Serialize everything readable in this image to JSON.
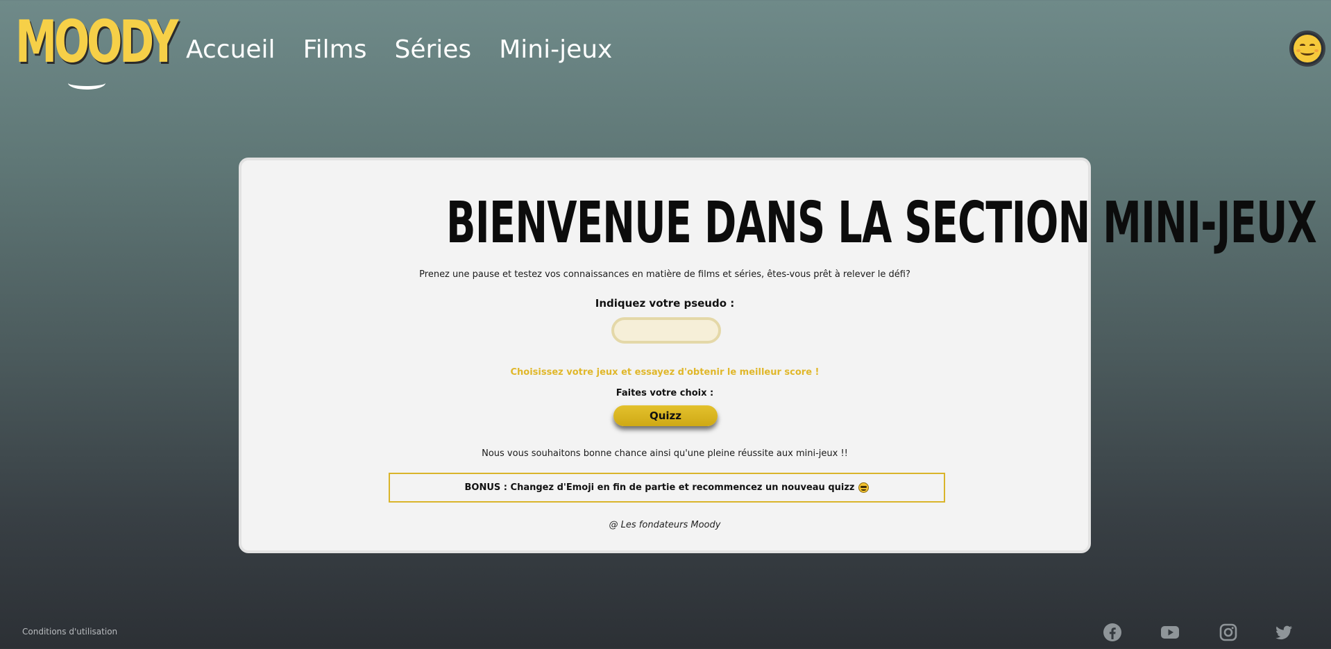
{
  "header": {
    "logo_text": "MOODY",
    "nav": [
      {
        "label": "Accueil"
      },
      {
        "label": "Films"
      },
      {
        "label": "Séries"
      },
      {
        "label": "Mini-jeux"
      }
    ],
    "avatar_icon": "smiling-face-icon"
  },
  "main": {
    "title": "BIENVENUE DANS LA SECTION MINI-JEUX",
    "intro": "Prenez une pause et testez vos connaissances en matière de films et séries, êtes-vous prêt à relever le défi?",
    "pseudo_label": "Indiquez votre pseudo :",
    "pseudo_value": "",
    "choose_text": "Choisissez votre jeux et essayez d'obtenir le meilleur score !",
    "choice_label": "Faites votre choix :",
    "quizz_button": "Quizz",
    "good_luck": "Nous vous souhaitons bonne chance ainsi qu'une pleine réussite aux mini-jeux !!",
    "bonus": "BONUS : Changez d'Emoji en fin de partie et recommencez un nouveau quizz",
    "signature": "@ Les fondateurs Moody"
  },
  "footer": {
    "terms": "Conditions d'utilisation",
    "social": [
      "facebook-icon",
      "youtube-icon",
      "instagram-icon",
      "twitter-icon"
    ]
  },
  "colors": {
    "accent_yellow": "#f6d048",
    "button_yellow": "#d9b420",
    "card_bg": "#f3f3f3"
  }
}
